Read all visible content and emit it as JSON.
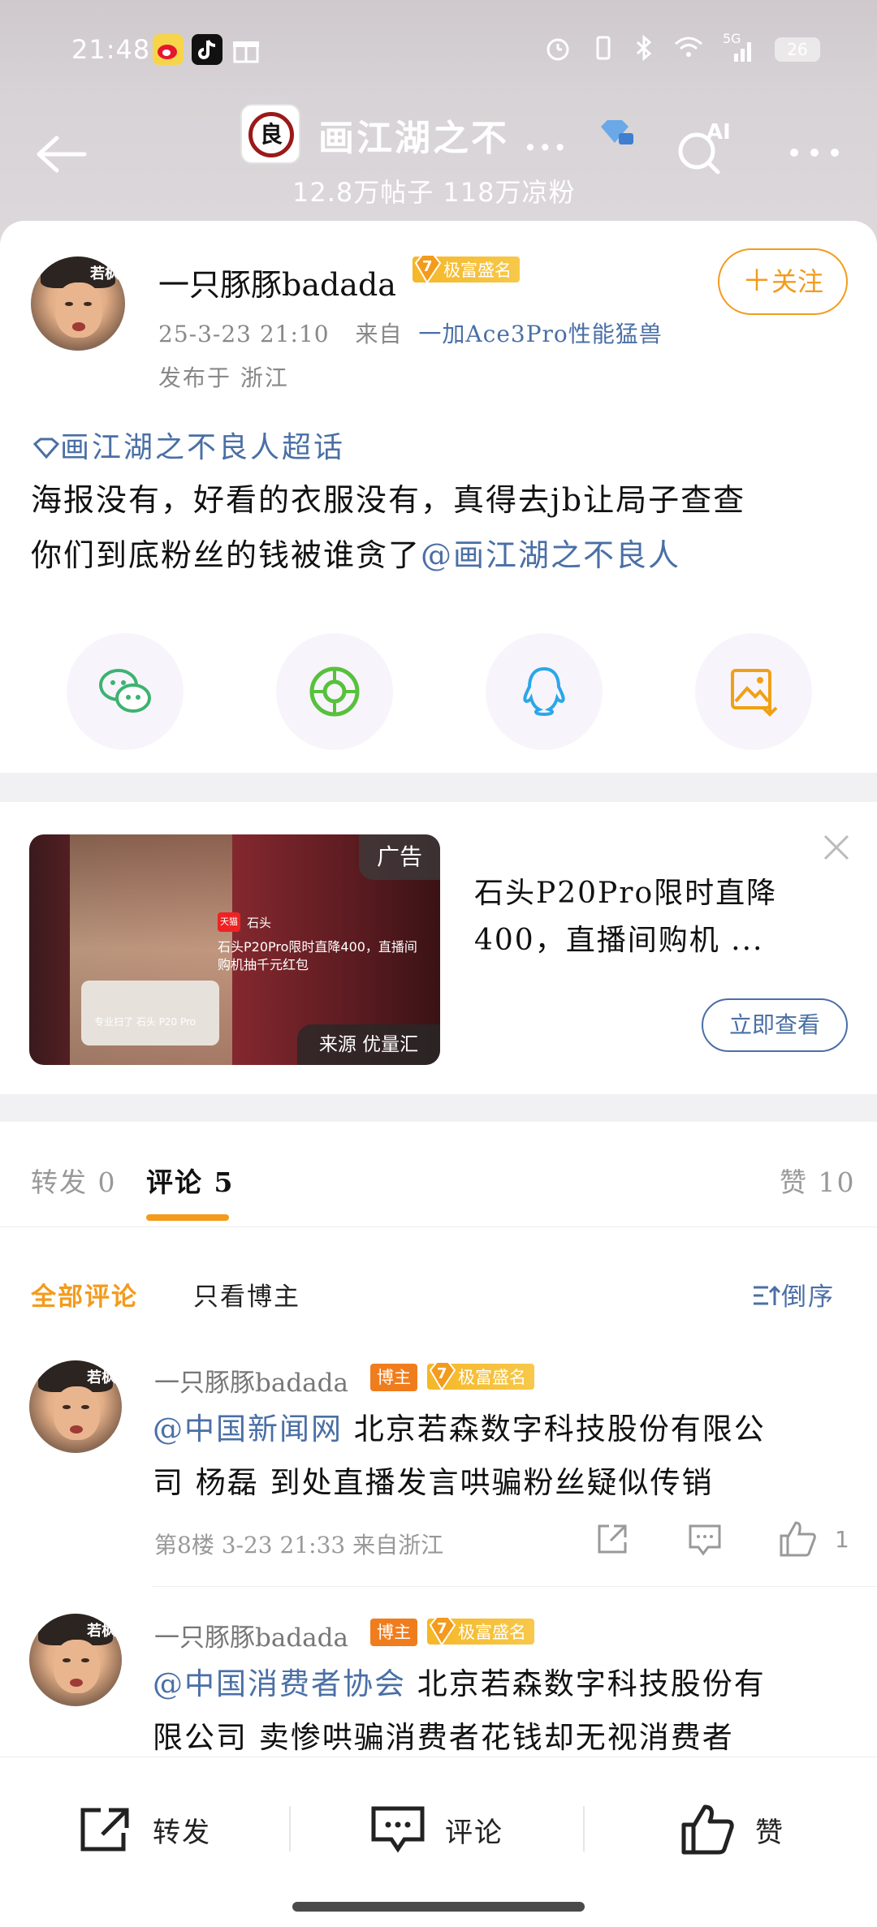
{
  "status_bar": {
    "time": "21:48",
    "network": "5G",
    "battery": "26"
  },
  "header": {
    "topic_title": "画江湖之不 ...",
    "stats": "12.8万帖子 118万凉粉",
    "ai_label": "AI",
    "topic_logo_text": "良"
  },
  "post": {
    "author": "一只豚豚badada",
    "level": "7",
    "fame": "极富盛名",
    "date": "25-3-23 21:10",
    "from_label": "来自",
    "source": "一加Ace3Pro性能猛兽",
    "location": "发布于 浙江",
    "follow_label": "关注",
    "topic_link": "画江湖之不良人超话",
    "text_line1": "海报没有，好看的衣服没有，真得去jb让局子查查",
    "text_line2": "你们到底粉丝的钱被谁贪了",
    "mention": "@画江湖之不良人",
    "avatar_tag": "若枫"
  },
  "ad": {
    "label": "广告",
    "source": "来源 优量汇",
    "title": "石头P20Pro限时直降400，直播间购机 ...",
    "cta": "立即查看",
    "img_badge": "天猫",
    "img_brand": "石头",
    "img_promo": "石头P20Pro限时直降400，直播间购机抽千元红包",
    "img_small": "专业扫了 石头 P20 Pro"
  },
  "tabs": {
    "repost": "转发 0",
    "comments": "评论 5",
    "likes": "赞 10"
  },
  "filters": {
    "all": "全部评论",
    "author_only": "只看博主",
    "sort": "倒序"
  },
  "comments": [
    {
      "name": "一只豚豚badada",
      "badge": "博主",
      "level": "7",
      "fame": "极富盛名",
      "mention": "@中国新闻网",
      "text_line1": " 北京若森数字科技股份有限公",
      "text_line2": "司 杨磊 到处直播发言哄骗粉丝疑似传销",
      "meta": "第8楼 3-23 21:33 来自浙江",
      "likes": "1"
    },
    {
      "name": "一只豚豚badada",
      "badge": "博主",
      "level": "7",
      "fame": "极富盛名",
      "mention": "@中国消费者协会",
      "text_line1": " 北京若森数字科技股份有",
      "text_line2": "限公司 卖惨哄骗消费者花钱却无视消费者"
    }
  ],
  "bottom_bar": {
    "repost": "转发",
    "comment": "评论",
    "like": "赞"
  },
  "colors": {
    "accent": "#f39b1c",
    "link": "#4a6fa5",
    "fame": "#f5b728",
    "badge": "#f07d1d"
  }
}
